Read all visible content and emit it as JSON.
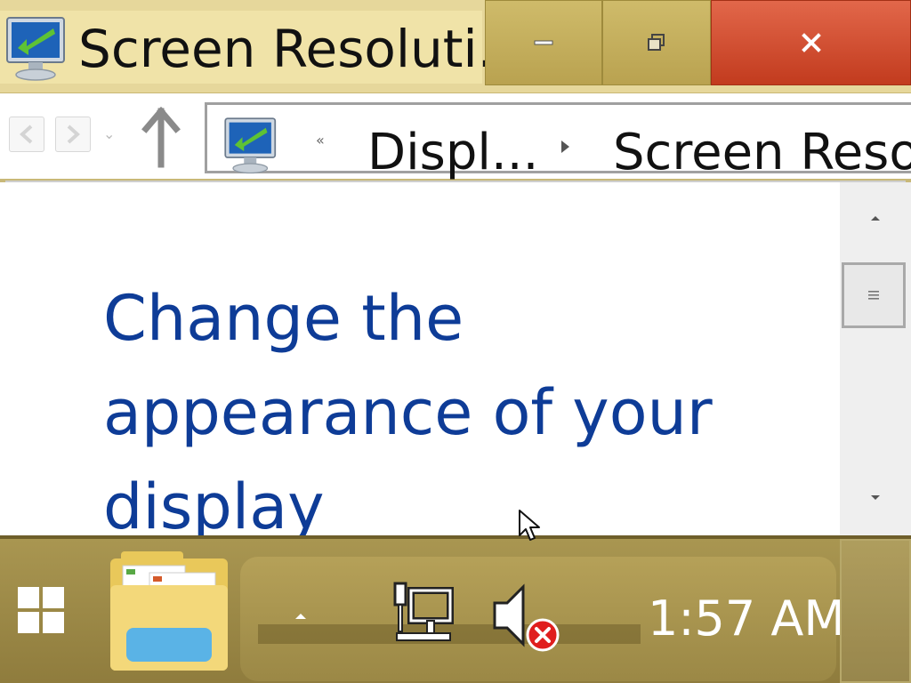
{
  "window": {
    "title": "Screen Resoluti...",
    "icon": "display-monitor-icon"
  },
  "caption_buttons": {
    "minimize_icon": "minimize-icon",
    "maximize_icon": "restore-icon",
    "close_icon": "close-icon"
  },
  "navigation": {
    "back_icon": "back-arrow-icon",
    "forward_icon": "forward-arrow-icon",
    "up_icon": "up-arrow-icon",
    "breadcrumb": {
      "overflow_marker": "«",
      "items": [
        "Displ...",
        "Screen Resol"
      ]
    }
  },
  "content": {
    "heading": "Change the appearance of your display"
  },
  "scrollbar": {
    "up_icon": "scroll-up-icon",
    "down_icon": "scroll-down-icon",
    "grip_icon": "grip-icon"
  },
  "taskbar": {
    "start_icon": "windows-logo-icon",
    "pinned": [
      {
        "name": "File Explorer",
        "icon": "folder-icon"
      }
    ],
    "tray": {
      "chevron_icon": "show-hidden-icons-chevron",
      "network_icon": "network-wired-icon",
      "volume_icon": "volume-muted-icon"
    },
    "clock": "1:57 AM"
  },
  "colors": {
    "heading_blue": "#0e3c97",
    "titlebar": "#e6d79b",
    "close_red": "#d04a2c",
    "taskbar": "#9e8a47"
  }
}
